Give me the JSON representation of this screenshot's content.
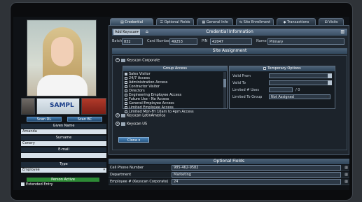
{
  "left": {
    "scan_dl": "Scan DL",
    "scan_bc": "Scan BC",
    "license_text": "SAMPL",
    "given_name_label": "Given Name",
    "given_name": "Amanda",
    "surname_label": "Surname",
    "surname": "Conery",
    "email_label": "E-mail",
    "email": "",
    "type_label": "Type",
    "type_value": "Employee",
    "person_active": "Person Active",
    "extended_entry": "Extended Entry"
  },
  "tabs": [
    {
      "label": "Credential Information"
    },
    {
      "label": "Optional Fields"
    },
    {
      "label": "General Info"
    },
    {
      "label": "Site Enrollment"
    },
    {
      "label": "Transactions"
    },
    {
      "label": "Visits"
    }
  ],
  "credential": {
    "add_keyscan": "Add Keyscan",
    "title": "Credential Information",
    "batch_label": "Batch",
    "batch": "832",
    "card_label": "Card Number",
    "card": "49253",
    "pin_label": "PIN",
    "pin": "42047",
    "name_label": "Name",
    "name": "Primary"
  },
  "site": {
    "title": "Site Assignment",
    "group1": "Keyscan Corporate",
    "group_access_title": "Group Access",
    "groups": [
      {
        "label": "Sales Visitor",
        "checked": true
      },
      {
        "label": "24/7 Access",
        "checked": false
      },
      {
        "label": "Administration Access",
        "checked": false
      },
      {
        "label": "Contractor Visitor",
        "checked": false
      },
      {
        "label": "Directors",
        "checked": false
      },
      {
        "label": "Engineering Employee Access",
        "checked": false
      },
      {
        "label": "Future Use - No Access",
        "checked": false
      },
      {
        "label": "General Employee Access",
        "checked": false
      },
      {
        "label": "Limited Employee Access",
        "checked": false
      },
      {
        "label": "Limited Mon-Fri 10am to 4pm Access",
        "checked": false
      }
    ],
    "temp_title": "Temporary Options",
    "valid_from_label": "Valid From",
    "valid_to_label": "Valid To",
    "limited_uses_label": "Limited # Uses",
    "limited_uses_suffix": "/ 0",
    "limited_group_label": "Limited To Group",
    "limited_group_value": "Not Assigned",
    "group2": "Keyscan LatinAmerica",
    "group3": "Keyscan US",
    "clone": "Clone"
  },
  "optional": {
    "title": "Optional Fields",
    "rows": [
      {
        "label": "Cell Phone Number",
        "value": "985-462-9582"
      },
      {
        "label": "Department",
        "value": "Marketing"
      },
      {
        "label": "Employee # (Keyscan Corporate)",
        "value": "24"
      }
    ]
  }
}
